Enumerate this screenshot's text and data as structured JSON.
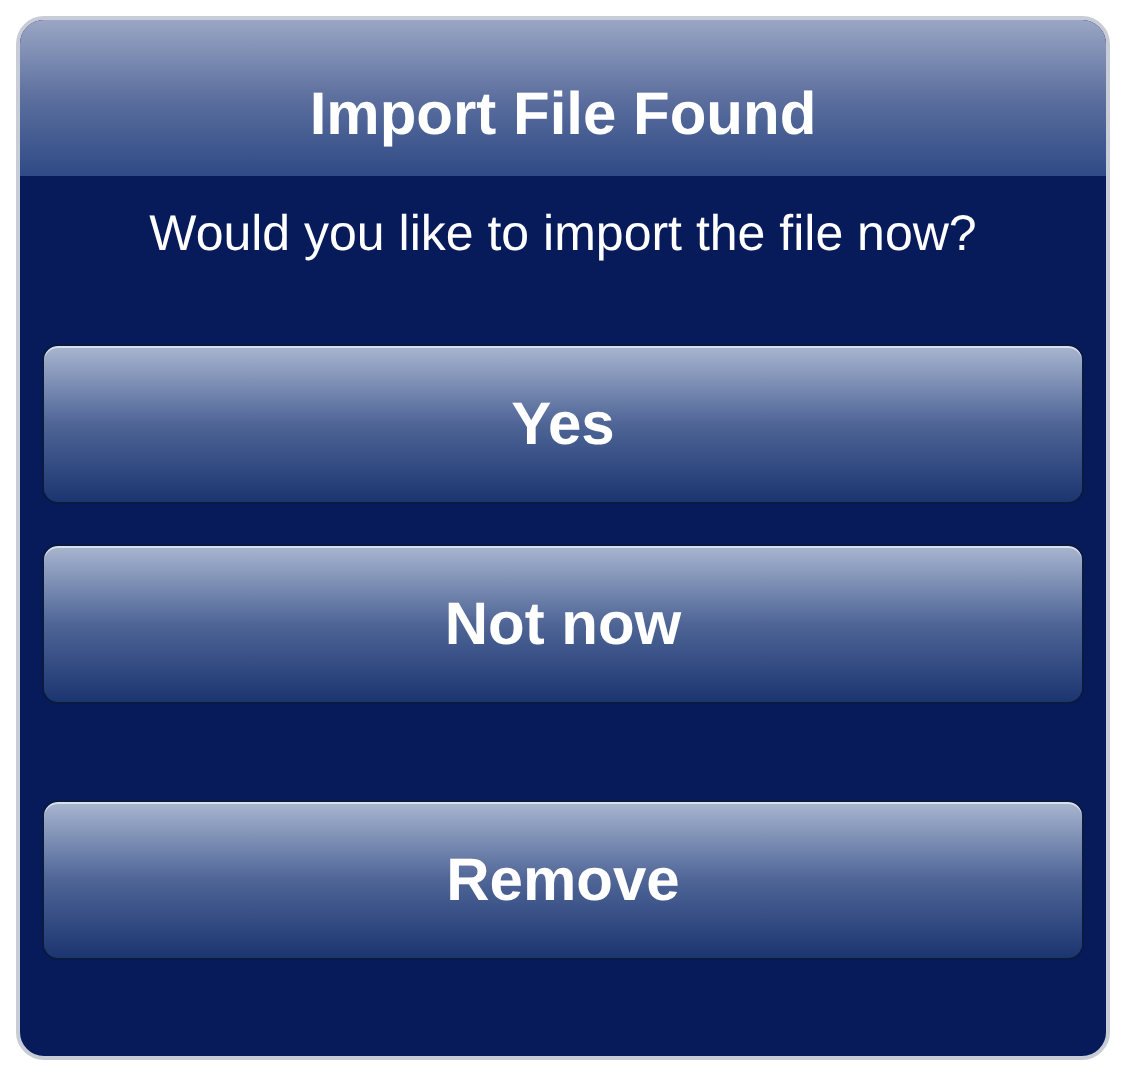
{
  "alert": {
    "title": "Import File Found",
    "message": "Would you like to import the file now?",
    "buttons": [
      {
        "label": "Yes"
      },
      {
        "label": "Not now"
      },
      {
        "label": "Remove"
      }
    ]
  }
}
